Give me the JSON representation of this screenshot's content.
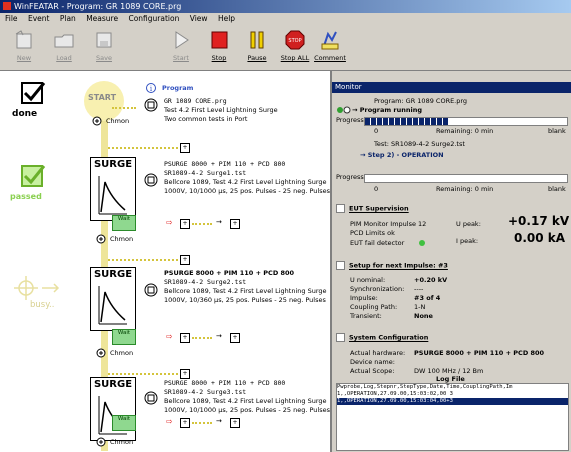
{
  "window": {
    "title": "WinFEATAR - Program: GR 1089 CORE.prg"
  },
  "menu": [
    "File",
    "Event",
    "Plan",
    "Measure",
    "Configuration",
    "View",
    "Help"
  ],
  "toolbar": {
    "buttons": [
      {
        "label": "New",
        "enabled": false
      },
      {
        "label": "Load",
        "enabled": false
      },
      {
        "label": "Save",
        "enabled": false
      },
      {
        "label": "Start",
        "enabled": false
      },
      {
        "label": "Stop",
        "enabled": true
      },
      {
        "label": "Pause",
        "enabled": true
      },
      {
        "label": "Stop ALL",
        "enabled": true
      },
      {
        "label": "Comment",
        "enabled": true
      }
    ]
  },
  "status": {
    "done": "done",
    "passed": "passed",
    "busy": "busy.."
  },
  "sequence": {
    "start_label": "START",
    "program_header": "Program",
    "program_name": "GR 1089 CORE.prg",
    "program_desc": "Test 4.2 First Level Lightning Surge",
    "program_note": "Two common tests in Port",
    "chmon_label": "Chmon",
    "steps": [
      {
        "title": "SURGE",
        "line1": "PSURGE 8000 + PIM 110 + PCD 800",
        "line2": "SR1089-4-2 Surge1.tst",
        "line3": "Bellcore 1089, Test 4.2 First Level Lightning Surge",
        "line4": "1000V, 10/1000 µs, 25 pos. Pulses - 25 neg. Pulses",
        "badge": "Wait"
      },
      {
        "title": "SURGE",
        "line1": "PSURGE 8000 + PIM 110 + PCD 800",
        "line2": "SR1089-4-2 Surge2.tst",
        "line3": "Bellcore 1089, Test 4.2 First Level Lightning Surge",
        "line4": "1000V, 10/360 µs, 25 pos. Pulses - 25 neg. Pulses",
        "badge": "Wait"
      },
      {
        "title": "SURGE",
        "line1": "PSURGE 8000 + PIM 110 + PCD 800",
        "line2": "SR1089-4-2 Surge3.tst",
        "line3": "Bellcore 1089, Test 4.2 First Level Lightning Surge",
        "line4": "1000V, 10/1000 µs, 25 pos. Pulses - 25 neg. Pulses",
        "badge": "Wait"
      }
    ]
  },
  "monitor": {
    "title": "Monitor",
    "program_file": "Program: GR 1089 CORE.prg",
    "program_status": "Program running",
    "progress_label": "Progress",
    "progress_program": 0.41,
    "zero": "0",
    "remaining_label": "Remaining: 0 min",
    "remaining_label2": "Remaining: 0 min",
    "blank_right": "blank",
    "test_file": "Test: SR1089-4-2 Surge2.tst",
    "step_label": "Step 2) - OPERATION",
    "progress_step": 0,
    "eut_sup_title": "EUT Supervision",
    "pim_monitor": "PIM Monitor Impulse 12",
    "u_peak_label": "U peak:",
    "u_peak_value": "+0.17 kV",
    "pcd_limits": "PCD Limits ok",
    "i_peak_label": "I peak:",
    "i_peak_value": "0.00 kA",
    "eut_fail": "EUT fail detector",
    "setup_title": "Setup for next Impulse: #3",
    "u_nominal_label": "U nominal:",
    "u_nominal_value": "+0.20 kV",
    "sync_label": "Synchronization:",
    "sync_value": "----",
    "impulse_label": "Impulse:",
    "impulse_value": "#3 of 4",
    "coupling_label": "Coupling Path:",
    "coupling_value": "1-N",
    "transient_label": "Transient:",
    "transient_value": "None",
    "sys_conf_title": "System Configuration",
    "actual_hw_label": "Actual hardware:",
    "actual_hw_value": "PSURGE 8000 + PIM 110 + PCD 800",
    "device_label": "Device name:",
    "device_value": "",
    "actual_scope_label": "Actual Scope:",
    "actual_scope_value": "DW 100 MHz / 12 Bm",
    "log_title": "Log File",
    "log_rows": [
      "Pwprobe,Log,Stepnr,StepType,Date,Time,CouplingPath,Im",
      "1,,OPERATION,27.09.00,15:03:02,00 3",
      "1,,OPERATION,27.09.00,15:03:04,00+3"
    ]
  }
}
